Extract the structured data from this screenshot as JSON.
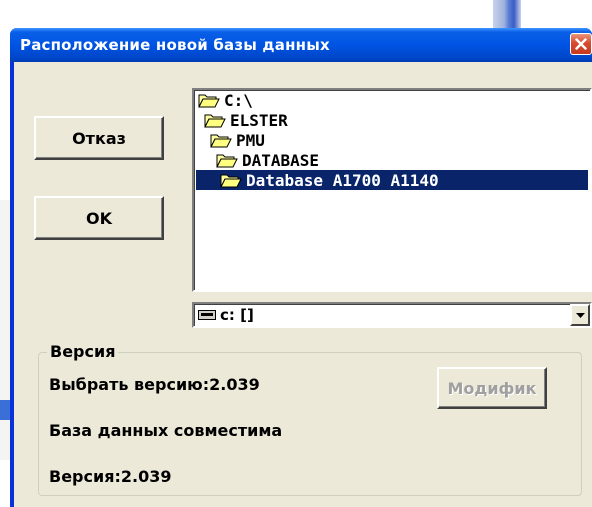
{
  "window": {
    "title": "Расположение новой базы данных",
    "close_icon": "close-icon"
  },
  "buttons": {
    "cancel_label": "Отказ",
    "ok_label": "OK",
    "modify_label": "Модифик"
  },
  "tree": {
    "items": [
      {
        "label": "C:\\",
        "icon": "open-folder-icon",
        "selected": false
      },
      {
        "label": "ELSTER",
        "icon": "open-folder-icon",
        "selected": false
      },
      {
        "label": "PMU",
        "icon": "open-folder-icon",
        "selected": false
      },
      {
        "label": "DATABASE",
        "icon": "open-folder-icon",
        "selected": false
      },
      {
        "label": "Database A1700 A1140",
        "icon": "open-folder-icon",
        "selected": true
      }
    ]
  },
  "drive": {
    "value": "c: []",
    "icon": "drive-icon"
  },
  "version_group": {
    "legend": "Версия",
    "select_version_label": "Выбрать версию:2.039",
    "compatibility_label": "База данных совместима",
    "version_label": "Версия:2.039"
  },
  "colors": {
    "titlebar": "#0054e3",
    "dialog_bg": "#ece9d8",
    "selection": "#0a246a",
    "close_button": "#d84b2f"
  }
}
